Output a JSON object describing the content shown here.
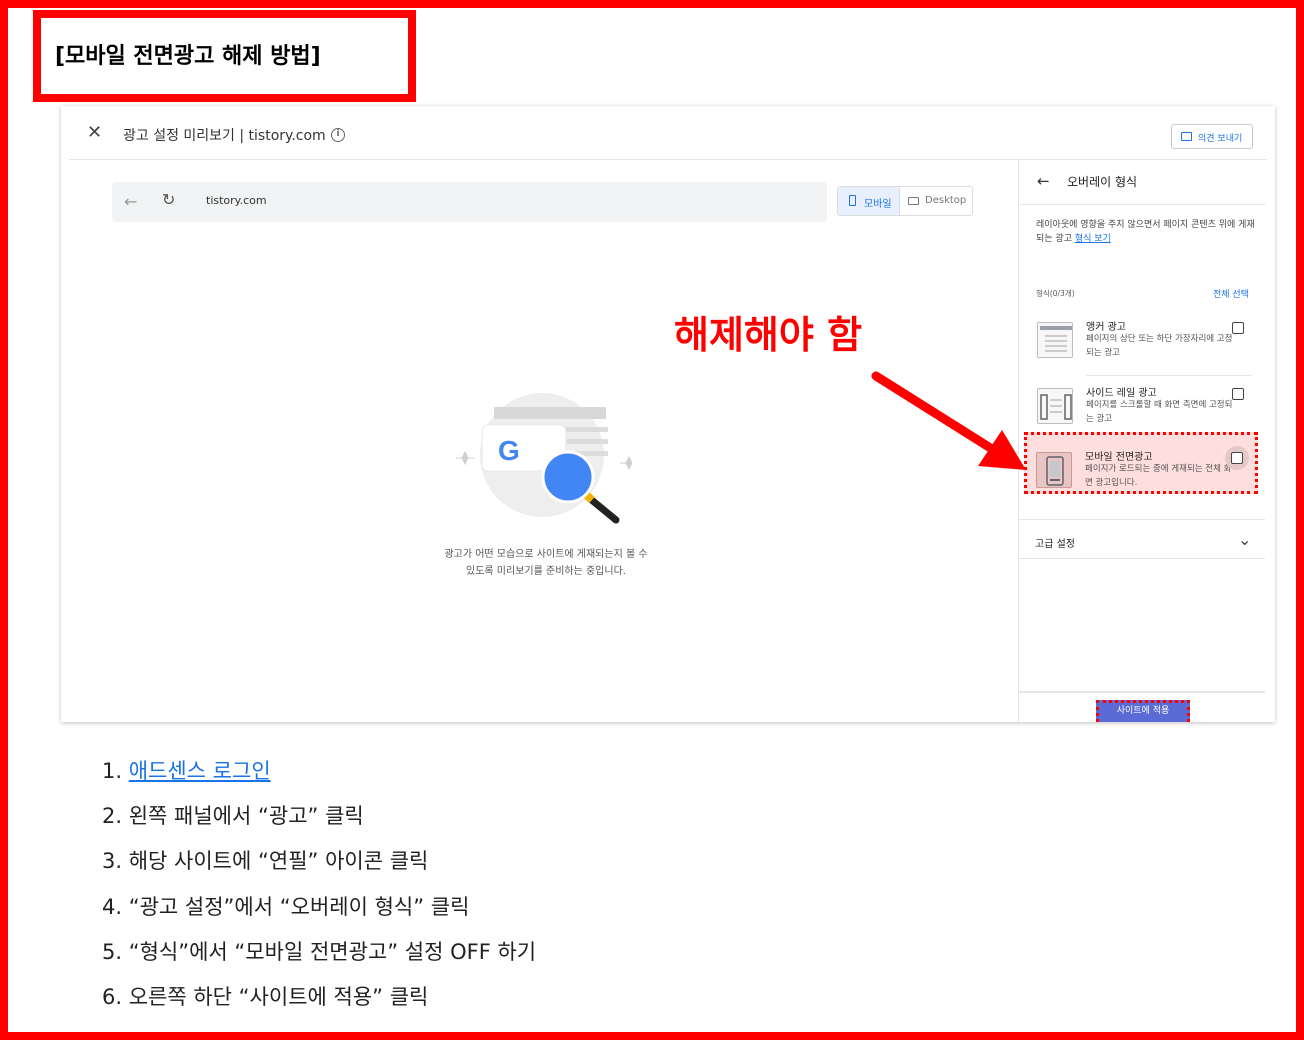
{
  "doc_title": "[모바일 전면광고 해제 방법]",
  "preview": {
    "close_glyph": "✕",
    "title": "광고 설정 미리보기 | tistory.com",
    "info_glyph": "i",
    "feedback_label": "의견 보내기",
    "browser": {
      "back_glyph": "←",
      "reload_glyph": "↻",
      "url": "tistory.com",
      "mobile_label": "모바일",
      "desktop_label": "Desktop"
    },
    "illustration": {
      "google_letter": "G",
      "line1": "광고가 어떤 모습으로 사이트에 게재되는지 볼 수",
      "line2": "있도록 미리보기를 준비하는 중입니다."
    },
    "panel": {
      "back_glyph": "←",
      "title": "오버레이 형식",
      "description": "레이아웃에 영향을 주지 않으면서 페이지 콘텐츠 위에 게재되는 광고 ",
      "description_link": "형식 보기",
      "formats_label": "형식(0/3개)",
      "select_all": "전체 선택",
      "formats": [
        {
          "name": "앵커 광고",
          "desc": "페이지의 상단 또는 하단 가장자리에 고정되는 광고",
          "checked": false
        },
        {
          "name": "사이드 레일 광고",
          "desc": "페이지를 스크롤할 때 화면 측면에 고정되는 광고",
          "checked": false
        },
        {
          "name": "모바일 전면광고",
          "desc": "페이지가 로드되는 중에 게재되는 전체 화면 광고입니다.",
          "checked": false
        }
      ],
      "advanced_label": "고급 설정",
      "advanced_chevron": "⌄",
      "apply_label": "사이트에 적용"
    }
  },
  "annotation": "해제해야 함",
  "colors": {
    "highlight_red": "#ff0000",
    "link_blue": "#1a73e8",
    "apply_button": "#5b6bd6"
  },
  "steps": [
    {
      "num": "1. ",
      "link": "애드센스 로그인 ",
      "text": ""
    },
    {
      "num": "2. ",
      "link": "",
      "text": "왼쪽 패널에서 “광고” 클릭"
    },
    {
      "num": "3. ",
      "link": "",
      "text": "해당 사이트에 “연필” 아이콘 클릭"
    },
    {
      "num": "4. ",
      "link": "",
      "text": "“광고 설정”에서 “오버레이 형식” 클릭"
    },
    {
      "num": "5. ",
      "link": "",
      "text": "“형식”에서 “모바일 전면광고” 설정 OFF 하기"
    },
    {
      "num": "6. ",
      "link": "",
      "text": "오른쪽 하단 “사이트에 적용” 클릭"
    }
  ]
}
